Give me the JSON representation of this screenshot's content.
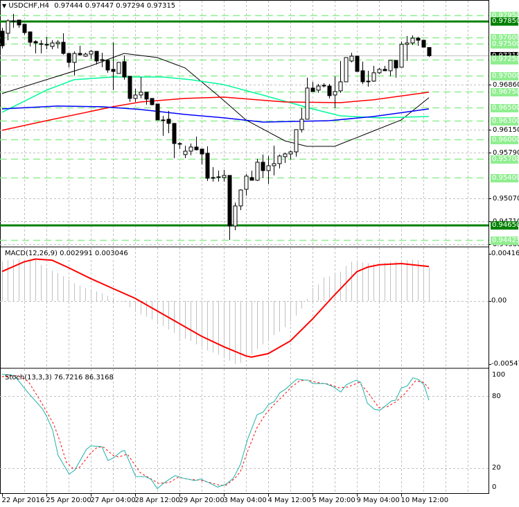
{
  "header": {
    "symbol_label": "USDCHF,H4",
    "ohlc": "0.97444 0.97447 0.97294 0.97315",
    "dropdown_icon": "triangle-down-icon"
  },
  "colors": {
    "level_major": "#008000",
    "level_minor": "#90EE90",
    "ma_fast": "#000000",
    "ma_green": "#00FA9A",
    "ma_red": "#FF0000",
    "ma_blue": "#0000FF",
    "macd_hist": "#C0C0C0",
    "macd_signal": "#FF0000",
    "stoch_main": "#20B2AA",
    "stoch_signal": "#FF0000",
    "grid": "#C0C0C0"
  },
  "main_chart": {
    "type": "candlestick",
    "current_price": "0.97315",
    "price_ticks": [
      "0.96860",
      "0.96150",
      "0.95790",
      "0.95070",
      "0.94710",
      "0.94360"
    ],
    "major_levels": [
      "0.97850",
      "0.94650"
    ],
    "minor_levels": [
      "0.97950",
      "0.97600",
      "0.97500",
      "0.97250",
      "0.97000",
      "0.96750",
      "0.96500",
      "0.96300",
      "0.96000",
      "0.95700",
      "0.95400",
      "0.94425"
    ],
    "candles": [
      [
        0.977,
        0.97754,
        0.97428,
        0.97471
      ],
      [
        0.97667,
        0.97885,
        0.97558,
        0.97863
      ],
      [
        0.97863,
        0.97972,
        0.97754,
        0.97863
      ],
      [
        0.97874,
        0.97874,
        0.97754,
        0.97798
      ],
      [
        0.97809,
        0.97809,
        0.97645,
        0.97678
      ],
      [
        0.97689,
        0.97689,
        0.9746,
        0.97526
      ],
      [
        0.97537,
        0.97558,
        0.97351,
        0.97515
      ],
      [
        0.97504,
        0.97558,
        0.97351,
        0.97504
      ],
      [
        0.97493,
        0.97613,
        0.97417,
        0.97493
      ],
      [
        0.9746,
        0.97558,
        0.97417,
        0.97515
      ],
      [
        0.97504,
        0.97558,
        0.97428,
        0.97526
      ],
      [
        0.97526,
        0.97667,
        0.9733,
        0.97351
      ],
      [
        0.97351,
        0.97351,
        0.97134,
        0.9721
      ],
      [
        0.9721,
        0.97384,
        0.97003,
        0.97351
      ],
      [
        0.97351,
        0.97471,
        0.97319,
        0.9733
      ],
      [
        0.97308,
        0.97362,
        0.97297,
        0.9734
      ],
      [
        0.9734,
        0.97406,
        0.97264,
        0.97384
      ],
      [
        0.97384,
        0.97384,
        0.97177,
        0.97232
      ],
      [
        0.97253,
        0.97362,
        0.97134,
        0.97253
      ],
      [
        0.97242,
        0.97242,
        0.97047,
        0.9709
      ],
      [
        0.97101,
        0.97526,
        0.96774,
        0.97068
      ],
      [
        0.97036,
        0.9721,
        0.97036,
        0.9721
      ],
      [
        0.97221,
        0.97319,
        0.96938,
        0.96981
      ],
      [
        0.96992,
        0.96992,
        0.9659,
        0.96644
      ],
      [
        0.96644,
        0.96796,
        0.9659,
        0.96698
      ],
      [
        0.96698,
        0.96981,
        0.96644,
        0.96742
      ],
      [
        0.96742,
        0.96742,
        0.96546,
        0.96633
      ],
      [
        0.96644,
        0.96644,
        0.96535,
        0.96546
      ],
      [
        0.96557,
        0.96557,
        0.96306,
        0.96306
      ],
      [
        0.96306,
        0.96371,
        0.96056,
        0.96306
      ],
      [
        0.96317,
        0.96448,
        0.96099,
        0.96252
      ],
      [
        0.96252,
        0.96252,
        0.95707,
        0.95936
      ],
      [
        0.95936,
        0.95958,
        0.95849,
        0.95936
      ],
      [
        0.95762,
        0.95903,
        0.95707,
        0.95816
      ],
      [
        0.95816,
        0.95936,
        0.95751,
        0.95881
      ],
      [
        0.95881,
        0.96045,
        0.95827,
        0.95838
      ],
      [
        0.95849,
        0.95849,
        0.95609,
        0.95772
      ],
      [
        0.95783,
        0.95892,
        0.95348,
        0.95391
      ],
      [
        0.95402,
        0.95565,
        0.95337,
        0.95402
      ],
      [
        0.95413,
        0.95511,
        0.95337,
        0.95413
      ],
      [
        0.95402,
        0.95522,
        0.95337,
        0.95435
      ],
      [
        0.95435,
        0.95435,
        0.94422,
        0.9464
      ],
      [
        0.9464,
        0.9501,
        0.94575,
        0.94956
      ],
      [
        0.94956,
        0.95217,
        0.9489,
        0.95206
      ],
      [
        0.95217,
        0.95457,
        0.95119,
        0.95424
      ],
      [
        0.95402,
        0.95511,
        0.95359,
        0.95359
      ],
      [
        0.95359,
        0.95696,
        0.95348,
        0.95642
      ],
      [
        0.95642,
        0.95762,
        0.95391,
        0.95511
      ],
      [
        0.95511,
        0.9574,
        0.95304,
        0.95587
      ],
      [
        0.95587,
        0.95903,
        0.95435,
        0.9562
      ],
      [
        0.9562,
        0.95762,
        0.95544,
        0.9574
      ],
      [
        0.95729,
        0.95794,
        0.95631,
        0.95772
      ],
      [
        0.95772,
        0.95827,
        0.95685,
        0.95805
      ],
      [
        0.95805,
        0.96154,
        0.95729,
        0.96154
      ],
      [
        0.96154,
        0.96491,
        0.9611,
        0.96317
      ],
      [
        0.96317,
        0.9697,
        0.96317,
        0.96807
      ],
      [
        0.96807,
        0.96905,
        0.96752,
        0.96752
      ],
      [
        0.96774,
        0.96872,
        0.96731,
        0.96839
      ],
      [
        0.9685,
        0.96883,
        0.96818,
        0.9685
      ],
      [
        0.96839,
        0.96872,
        0.96644,
        0.96687
      ],
      [
        0.96698,
        0.96992,
        0.96491,
        0.96752
      ],
      [
        0.96763,
        0.97232,
        0.96731,
        0.96905
      ],
      [
        0.96905,
        0.97286,
        0.96905,
        0.97286
      ],
      [
        0.97232,
        0.97362,
        0.9721,
        0.97308
      ],
      [
        0.97308,
        0.97308,
        0.97068,
        0.97068
      ],
      [
        0.97079,
        0.97221,
        0.96872,
        0.96905
      ],
      [
        0.96916,
        0.97079,
        0.96829,
        0.96916
      ],
      [
        0.96916,
        0.97155,
        0.96905,
        0.97047
      ],
      [
        0.97047,
        0.97123,
        0.97025,
        0.97101
      ],
      [
        0.97101,
        0.97155,
        0.97079,
        0.97079
      ],
      [
        0.97079,
        0.97242,
        0.96992,
        0.97242
      ],
      [
        0.97242,
        0.97242,
        0.9697,
        0.97123
      ],
      [
        0.97134,
        0.97537,
        0.97134,
        0.97493
      ],
      [
        0.97493,
        0.97624,
        0.97232,
        0.97515
      ],
      [
        0.97515,
        0.97635,
        0.97482,
        0.97591
      ],
      [
        0.97591,
        0.97613,
        0.97471,
        0.97558
      ],
      [
        0.97558,
        0.97558,
        0.97449,
        0.97449
      ],
      [
        0.97444,
        0.97447,
        0.97294,
        0.97315
      ]
    ],
    "moving_averages": [
      {
        "color_key": "ma_fast",
        "points": [
          [
            0,
            0.9672
          ],
          [
            8,
            0.96938
          ],
          [
            16,
            0.97155
          ],
          [
            22,
            0.97351
          ],
          [
            28,
            0.97286
          ],
          [
            33,
            0.97123
          ],
          [
            39,
            0.96687
          ],
          [
            44,
            0.96306
          ],
          [
            51,
            0.95979
          ],
          [
            55,
            0.95892
          ],
          [
            60,
            0.95892
          ],
          [
            66,
            0.96099
          ],
          [
            72,
            0.96306
          ],
          [
            77,
            0.96655
          ]
        ]
      },
      {
        "color_key": "ma_green",
        "points": [
          [
            0,
            0.96426
          ],
          [
            8,
            0.96774
          ],
          [
            13,
            0.96938
          ],
          [
            20,
            0.96981
          ],
          [
            29,
            0.96981
          ],
          [
            34,
            0.96938
          ],
          [
            40,
            0.96861
          ],
          [
            47,
            0.96698
          ],
          [
            56,
            0.9648
          ],
          [
            61,
            0.96371
          ],
          [
            68,
            0.96339
          ],
          [
            77,
            0.9636
          ]
        ]
      },
      {
        "color_key": "ma_red",
        "points": [
          [
            0,
            0.96143
          ],
          [
            8,
            0.96295
          ],
          [
            20,
            0.96513
          ],
          [
            25,
            0.96589
          ],
          [
            33,
            0.96644
          ],
          [
            40,
            0.96665
          ],
          [
            51,
            0.96589
          ],
          [
            61,
            0.96578
          ],
          [
            67,
            0.96622
          ],
          [
            77,
            0.96742
          ]
        ]
      },
      {
        "color_key": "ma_blue",
        "points": [
          [
            0,
            0.9648
          ],
          [
            10,
            0.96524
          ],
          [
            18,
            0.96513
          ],
          [
            25,
            0.9647
          ],
          [
            33,
            0.96393
          ],
          [
            40,
            0.96339
          ],
          [
            47,
            0.96273
          ],
          [
            59,
            0.96295
          ],
          [
            67,
            0.9636
          ],
          [
            77,
            0.9648
          ]
        ]
      }
    ]
  },
  "macd": {
    "label": "MACD(12,26,9) 0.002991 0.003046",
    "axis_labels": [
      "0.004167",
      "0.00",
      "-0.005476"
    ],
    "ylim": [
      -0.005476,
      0.004167
    ],
    "histogram": [
      0.00351,
      0.00361,
      0.00367,
      0.00371,
      0.00367,
      0.00361,
      0.00361,
      0.0032,
      0.00294,
      0.00269,
      0.00249,
      0.00218,
      0.00188,
      0.00157,
      0.00137,
      0.00116,
      0.00106,
      0.00086,
      0.00069,
      0.00045,
      0.00014,
      4e-05,
      -6e-05,
      -0.00057,
      -0.00092,
      -0.00118,
      -0.00139,
      -0.00163,
      -0.002,
      -0.0022,
      -0.00251,
      -0.00282,
      -0.00343,
      -0.00333,
      -0.00353,
      -0.00384,
      -0.00404,
      -0.00435,
      -0.00455,
      -0.00476,
      -0.00506,
      -0.00527,
      -0.00557,
      -0.00547,
      -0.00506,
      -0.00476,
      -0.00424,
      -0.00384,
      -0.00353,
      -0.00302,
      -0.00271,
      -0.00231,
      -0.0018,
      -0.00129,
      -0.00067,
      0.0002,
      0.00116,
      0.00147,
      0.00208,
      0.00218,
      0.00249,
      0.00259,
      0.0031,
      0.00347,
      0.00351,
      0.00341,
      0.00335,
      0.0033,
      0.00335,
      0.00341,
      0.00347,
      0.00351,
      0.00355,
      0.00361,
      0.00363,
      0.00361,
      0.0033,
      0.002991
    ],
    "signal": [
      [
        0,
        0.00261
      ],
      [
        4,
        0.00347
      ],
      [
        6,
        0.00371
      ],
      [
        9,
        0.00361
      ],
      [
        12,
        0.00294
      ],
      [
        16,
        0.00198
      ],
      [
        20,
        0.0011
      ],
      [
        24,
        0.00024
      ],
      [
        28,
        -0.00088
      ],
      [
        32,
        -0.002
      ],
      [
        36,
        -0.00312
      ],
      [
        40,
        -0.00404
      ],
      [
        44,
        -0.00485
      ],
      [
        45,
        -0.00496
      ],
      [
        48,
        -0.00465
      ],
      [
        52,
        -0.00353
      ],
      [
        56,
        -0.00159
      ],
      [
        60,
        0.00055
      ],
      [
        64,
        0.00259
      ],
      [
        66,
        0.003
      ],
      [
        68,
        0.0032
      ],
      [
        72,
        0.00331
      ],
      [
        77,
        0.003046
      ]
    ]
  },
  "stochastic": {
    "label": "Stoch(13,3,3) 76.7216 86.3168",
    "axis_labels": [
      "100",
      "80",
      "20",
      "0"
    ],
    "levels": [
      80,
      20
    ],
    "main": [
      [
        0,
        98.3
      ],
      [
        2.2,
        97.3
      ],
      [
        4.7,
        82.9
      ],
      [
        7.3,
        69.4
      ],
      [
        8,
        63.7
      ],
      [
        9.1,
        52.1
      ],
      [
        10.1,
        31
      ],
      [
        12.1,
        15.2
      ],
      [
        13.1,
        18.5
      ],
      [
        15.2,
        35.8
      ],
      [
        16,
        38.7
      ],
      [
        18,
        38.1
      ],
      [
        19.1,
        26.5
      ],
      [
        20,
        28.5
      ],
      [
        21.6,
        34.4
      ],
      [
        22.1,
        34.8
      ],
      [
        24.1,
        13.3
      ],
      [
        25.9,
        13.1
      ],
      [
        26.9,
        10.8
      ],
      [
        28,
        3.1
      ],
      [
        29.2,
        7.9
      ],
      [
        31.2,
        14
      ],
      [
        32.8,
        11.7
      ],
      [
        34.8,
        9.8
      ],
      [
        35.8,
        11.2
      ],
      [
        37.4,
        7.9
      ],
      [
        38.9,
        4.4
      ],
      [
        40.4,
        6.9
      ],
      [
        41.7,
        11.7
      ],
      [
        43,
        23.3
      ],
      [
        44.3,
        44.4
      ],
      [
        46,
        64.6
      ],
      [
        47.1,
        66.9
      ],
      [
        48.1,
        73.3
      ],
      [
        49.1,
        75.6
      ],
      [
        50.1,
        82.9
      ],
      [
        51.1,
        85.8
      ],
      [
        53.2,
        94.4
      ],
      [
        54.5,
        93.5
      ],
      [
        55.2,
        93.5
      ],
      [
        56,
        90.6
      ],
      [
        58.3,
        90.6
      ],
      [
        59.8,
        87.7
      ],
      [
        61.1,
        83.5
      ],
      [
        62.1,
        89.6
      ],
      [
        63.9,
        93.5
      ],
      [
        64.7,
        91.5
      ],
      [
        65.9,
        74.2
      ],
      [
        67.2,
        69
      ],
      [
        68.2,
        68.5
      ],
      [
        70.3,
        76.2
      ],
      [
        71,
        76.7
      ],
      [
        72,
        86.7
      ],
      [
        73.1,
        88.7
      ],
      [
        74.1,
        95.4
      ],
      [
        75.1,
        94
      ],
      [
        76.1,
        89.6
      ],
      [
        77,
        76.7216
      ]
    ],
    "signal": [
      [
        0,
        96.3
      ],
      [
        2.7,
        97.3
      ],
      [
        4.7,
        92.5
      ],
      [
        6.8,
        77.1
      ],
      [
        8,
        67.5
      ],
      [
        9.3,
        56.9
      ],
      [
        10.3,
        44.4
      ],
      [
        11.6,
        25.2
      ],
      [
        12.9,
        19.4
      ],
      [
        13.9,
        20.4
      ],
      [
        16,
        32.9
      ],
      [
        17.2,
        37.7
      ],
      [
        18.3,
        37.7
      ],
      [
        20,
        31
      ],
      [
        21,
        29.4
      ],
      [
        22.6,
        31.9
      ],
      [
        23.6,
        25.2
      ],
      [
        24.9,
        16.5
      ],
      [
        26.7,
        11.7
      ],
      [
        28.2,
        7.5
      ],
      [
        30.2,
        8.3
      ],
      [
        31.8,
        12.7
      ],
      [
        33.8,
        10.8
      ],
      [
        35.8,
        10.2
      ],
      [
        37.4,
        8.3
      ],
      [
        39.2,
        6
      ],
      [
        40.4,
        6
      ],
      [
        42,
        11.7
      ],
      [
        43,
        17.5
      ],
      [
        44.5,
        36.7
      ],
      [
        46,
        54
      ],
      [
        47.6,
        65.6
      ],
      [
        49.1,
        73.3
      ],
      [
        50.6,
        80
      ],
      [
        52.2,
        87.7
      ],
      [
        53.7,
        92.9
      ],
      [
        55.2,
        93.5
      ],
      [
        56.7,
        91.5
      ],
      [
        58.8,
        90.2
      ],
      [
        60.8,
        87.1
      ],
      [
        62.4,
        87.7
      ],
      [
        64.4,
        91.5
      ],
      [
        65.9,
        83.8
      ],
      [
        68,
        70.4
      ],
      [
        69.5,
        71.3
      ],
      [
        71,
        75.2
      ],
      [
        72.6,
        81.9
      ],
      [
        74.6,
        92.9
      ],
      [
        76.1,
        91.5
      ],
      [
        77,
        86.3168
      ]
    ]
  },
  "time_axis": {
    "labels": [
      "22 Apr 2016",
      "25 Apr 20:00",
      "27 Apr 04:00",
      "28 Apr 12:00",
      "29 Apr 20:00",
      "3 May 04:00",
      "4 May 12:00",
      "5 May 20:00",
      "9 May 04:00",
      "10 May 12:00"
    ]
  }
}
